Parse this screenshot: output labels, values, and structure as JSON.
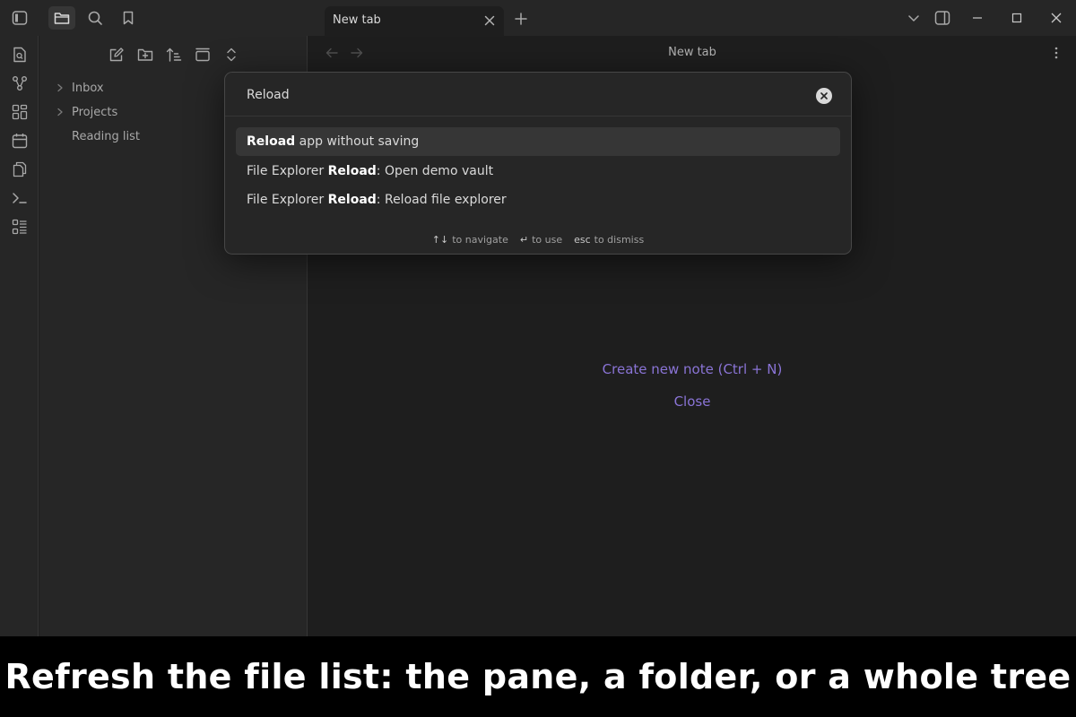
{
  "titlebar": {
    "tab_title": "New tab",
    "icons": [
      "sidebar-toggle-icon",
      "folder-icon",
      "search-icon",
      "bookmark-icon",
      "close-icon",
      "plus-icon",
      "chevron-down-icon",
      "right-sidebar-icon",
      "minimize-icon",
      "maximize-icon",
      "window-close-icon"
    ]
  },
  "ribbon": {
    "icons": [
      "open-quick-switcher-icon",
      "graph-view-icon",
      "canvas-icon",
      "daily-note-icon",
      "templates-icon",
      "command-palette-icon",
      "slides-icon"
    ]
  },
  "explorer": {
    "tools": [
      "new-note-icon",
      "new-folder-icon",
      "sort-icon",
      "collapse-view-icon",
      "expand-collapse-icon"
    ],
    "items": [
      {
        "label": "Inbox",
        "type": "folder"
      },
      {
        "label": "Projects",
        "type": "folder"
      },
      {
        "label": "Reading list",
        "type": "file"
      }
    ]
  },
  "main": {
    "view_title": "New tab",
    "create_note": "Create new note (Ctrl + N)",
    "close": "Close"
  },
  "palette": {
    "query": "Reload",
    "results": [
      {
        "prefix": "",
        "match": "Reload",
        "suffix": " app without saving"
      },
      {
        "prefix": "File Explorer ",
        "match": "Reload",
        "suffix": ": Open demo vault"
      },
      {
        "prefix": "File Explorer ",
        "match": "Reload",
        "suffix": ": Reload file explorer"
      }
    ],
    "hints": [
      {
        "key": "↑↓",
        "label": "to navigate"
      },
      {
        "key": "↵",
        "label": "to use"
      },
      {
        "key": "esc",
        "label": "to dismiss"
      }
    ]
  },
  "caption": "Refresh the file list: the pane, a folder, or a whole tree",
  "colors": {
    "accent": "#8a74d6",
    "background": "#1e1e1e",
    "panel": "#262626"
  }
}
